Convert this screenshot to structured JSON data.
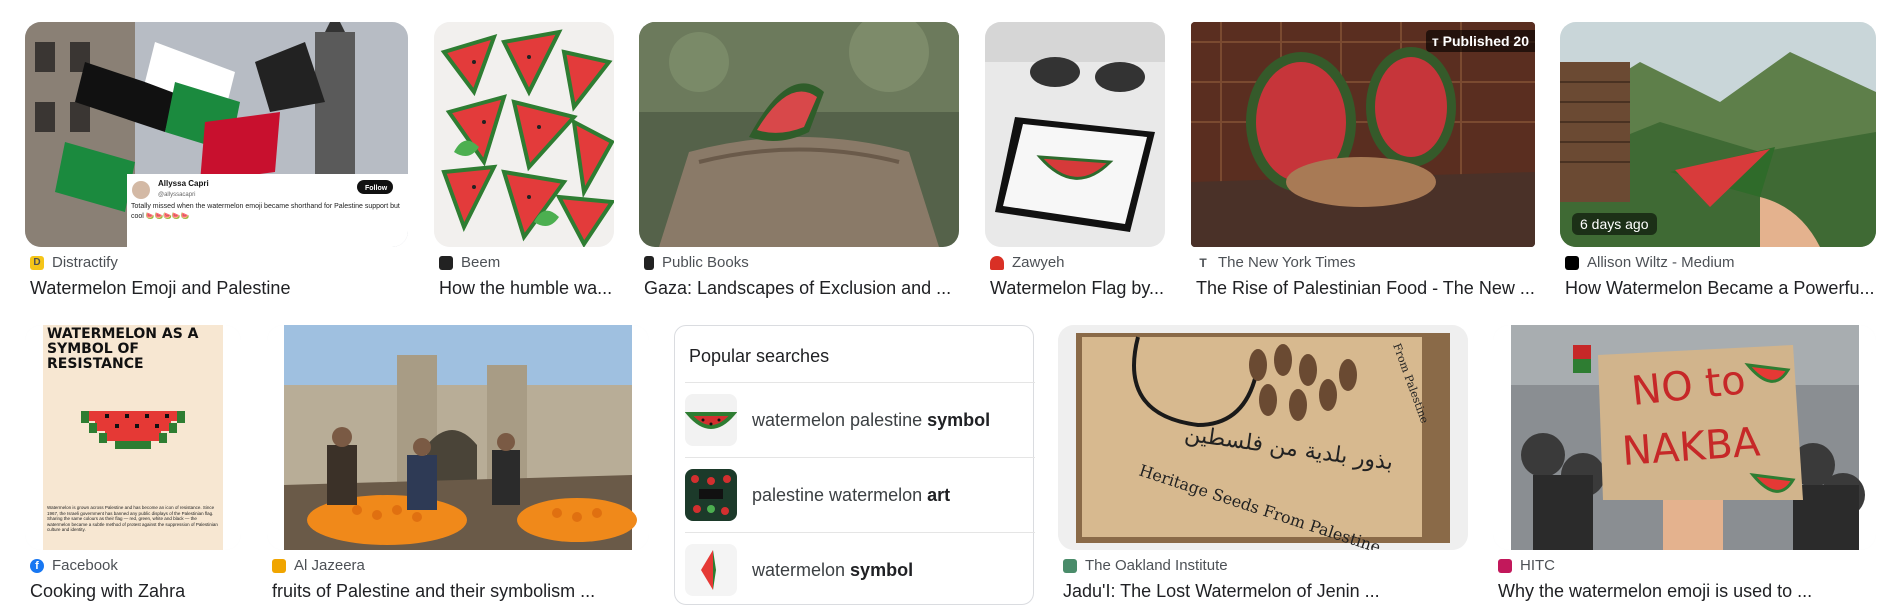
{
  "results": [
    {
      "source": "Distractify",
      "title": "Watermelon Emoji and Palestine",
      "favicon_color": "#f5c518",
      "favicon_text": "D"
    },
    {
      "source": "Beem",
      "title": "How the humble wa...",
      "favicon_color": "#222222",
      "favicon_text": ""
    },
    {
      "source": "Public Books",
      "title": "Gaza: Landscapes of Exclusion and ...",
      "favicon_color": "#222222",
      "favicon_text": ""
    },
    {
      "source": "Zawyeh",
      "title": "Watermelon Flag by...",
      "favicon_color": "#d93025",
      "favicon_text": ""
    },
    {
      "source": "The New York Times",
      "title": "The Rise of Palestinian Food - The New ...",
      "favicon_color": "#ffffff",
      "favicon_text": "T",
      "overlay": "ᴛ Published 20"
    },
    {
      "source": "Allison Wiltz - Medium",
      "title": "How Watermelon Became a Powerfu...",
      "favicon_color": "#000000",
      "favicon_text": "",
      "badge": "6 days ago"
    },
    {
      "source": "Facebook",
      "title": "Cooking with Zahra",
      "favicon_color": "#1877f2",
      "favicon_text": "f",
      "poster": {
        "heading": "WATERMELON AS A SYMBOL OF RESISTANCE",
        "body": "Watermelon is grown across Palestine and has become an icon of resistance. Since 1967, the Israeli government has banned any public displays of the Palestinian flag. Sharing the same colours as their flag — red, green, white and black — the watermelon became a subtle method of protest against the suppression of Palestinian culture and identity."
      }
    },
    {
      "source": "Al Jazeera",
      "title": "fruits of Palestine and their symbolism ...",
      "favicon_color": "#f0a500",
      "favicon_text": ""
    },
    {
      "source": "The Oakland Institute",
      "title": "Jadu'I: The Lost Watermelon of Jenin ...",
      "favicon_color": "#4a8c6a",
      "favicon_text": ""
    },
    {
      "source": "HITC",
      "title": "Why the watermelon emoji is used to ...",
      "favicon_color": "#c2185b",
      "favicon_text": ""
    }
  ],
  "tweet": {
    "name": "Allyssa Capri",
    "handle": "@allyssacapri",
    "follow": "Follow",
    "text": "Totally missed when the watermelon emoji became shorthand for Palestine support but cool 🍉🍉🍉🍉🍉"
  },
  "sign": {
    "line1": "NO to",
    "line2": "NAKBA"
  },
  "seeds": {
    "arabic": "بذور بلدية من فلسطين",
    "english": "Heritage Seeds From Palestine",
    "side": "From Palestine"
  },
  "popular": {
    "heading": "Popular searches",
    "items": [
      {
        "plain": "watermelon palestine ",
        "bold": "symbol"
      },
      {
        "plain": "palestine watermelon ",
        "bold": "art"
      },
      {
        "plain": "watermelon ",
        "bold": "symbol"
      }
    ]
  }
}
